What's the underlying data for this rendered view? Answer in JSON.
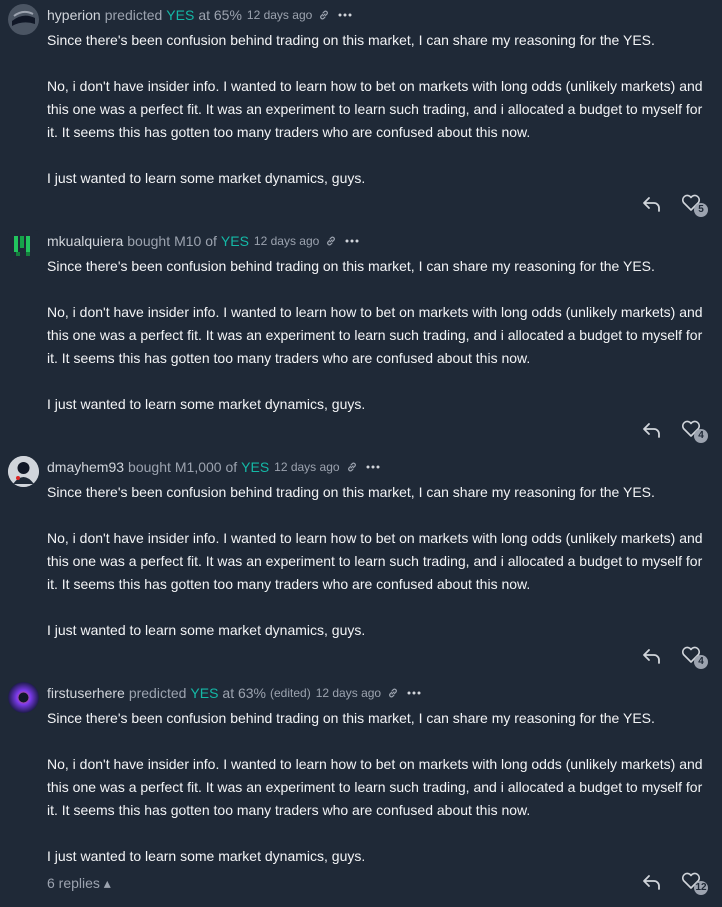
{
  "comments": [
    {
      "user": "hyperion",
      "action": "predicted",
      "outcome": "YES",
      "tail": "at 65%",
      "time": "12 days ago",
      "paragraphs": [
        "Since there's been confusion behind trading on this market, I can share my reasoning for the YES.",
        "No, i don't have insider info. I wanted to learn how to bet on markets with long odds (unlikely markets) and this one was a perfect fit. It was an experiment to learn such trading, and i allocated a budget to myself for it. It seems this has gotten too many traders who are confused about this now.",
        "I just wanted to learn some market dynamics, guys."
      ],
      "likes": "5"
    },
    {
      "user": "mkualquiera",
      "action": "bought",
      "amount": "M10 of",
      "outcome": "YES",
      "time": "12 days ago",
      "paragraphs": [
        "Since there's been confusion behind trading on this market, I can share my reasoning for the YES.",
        "No, i don't have insider info. I wanted to learn how to bet on markets with long odds (unlikely markets) and this one was a perfect fit. It was an experiment to learn such trading, and i allocated a budget to myself for it. It seems this has gotten too many traders who are confused about this now.",
        "I just wanted to learn some market dynamics, guys."
      ],
      "likes": "4"
    },
    {
      "user": "dmayhem93",
      "action": "bought",
      "amount": "M1,000 of",
      "outcome": "YES",
      "time": "12 days ago",
      "paragraphs": [
        "Since there's been confusion behind trading on this market, I can share my reasoning for the YES.",
        "No, i don't have insider info. I wanted to learn how to bet on markets with long odds (unlikely markets) and this one was a perfect fit. It was an experiment to learn such trading, and i allocated a budget to myself for it. It seems this has gotten too many traders who are confused about this now.",
        "I just wanted to learn some market dynamics, guys."
      ],
      "likes": "4"
    },
    {
      "user": "firstuserhere",
      "action": "predicted",
      "outcome": "YES",
      "tail": "at 63%",
      "edited": "(edited)",
      "time": "12 days ago",
      "paragraphs": [
        "Since there's been confusion behind trading on this market, I can share my reasoning for the YES.",
        "No, i don't have insider info. I wanted to learn how to bet on markets with long odds (unlikely markets) and this one was a perfect fit. It was an experiment to learn such trading, and i allocated a budget to myself for it. It seems this has gotten too many traders who are confused about this now.",
        "I just wanted to learn some market dynamics, guys."
      ],
      "likes": "12",
      "replies_label": "6 replies ▴"
    }
  ],
  "colors": {
    "background": "#1f2937",
    "accent_yes": "#14b8a6",
    "muted": "#9ca3af"
  }
}
